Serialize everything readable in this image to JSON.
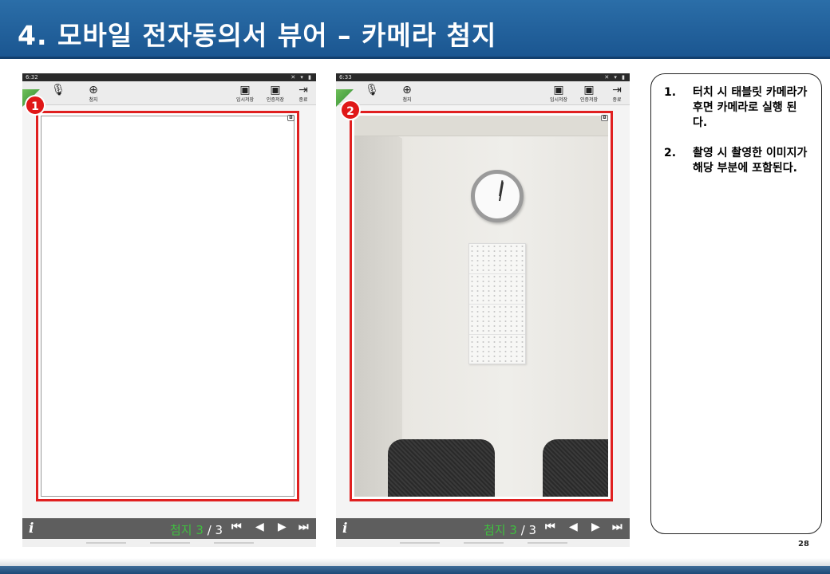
{
  "slide": {
    "title": "4. 모바일 전자동의서 뷰어 – 카메라 첨지",
    "page_number": "28"
  },
  "phones": [
    {
      "status_time": "6:32",
      "badge": "1",
      "toolbar": {
        "attach_label": "첨지",
        "temp_save_label": "임시저장",
        "cert_save_label": "인증저장",
        "exit_label": "종료"
      },
      "nav": {
        "info": "i",
        "current_label": "첨지 3",
        "total": " / 3"
      }
    },
    {
      "status_time": "6:33",
      "badge": "2",
      "toolbar": {
        "attach_label": "첨지",
        "temp_save_label": "임시저장",
        "cert_save_label": "인증저장",
        "exit_label": "종료"
      },
      "nav": {
        "info": "i",
        "current_label": "첨지 3",
        "total": " / 3"
      }
    }
  ],
  "steps": [
    {
      "num": "1.",
      "text": "터치 시 태블릿 카메라가 후면 카메라로 실행 된다."
    },
    {
      "num": "2.",
      "text": "촬영 시 촬영한 이미지가 해당 부분에 포함된다."
    }
  ],
  "colors": {
    "title_bar": "#1f5f9c",
    "highlight_red": "#e02020",
    "page_green": "#3fbf3f"
  }
}
